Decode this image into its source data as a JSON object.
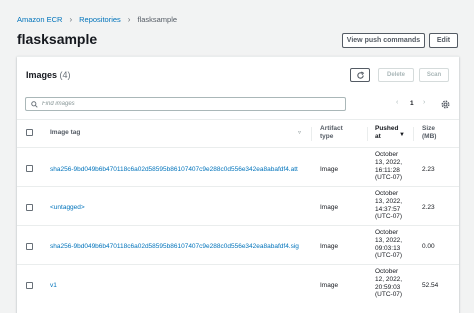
{
  "breadcrumb": [
    "Amazon ECR",
    "Repositories",
    "flasksample"
  ],
  "page": {
    "title": "flasksample",
    "view_push_commands": "View push commands",
    "edit": "Edit"
  },
  "images": {
    "title": "Images",
    "count": "(4)",
    "delete": "Delete",
    "scan": "Scan",
    "search_placeholder": "Find images",
    "page_number": "1",
    "columns": {
      "image_tag": "Image tag",
      "artifact_type": [
        "Artifact",
        "type"
      ],
      "pushed_at": [
        "Pushed",
        "at"
      ],
      "size": [
        "Size",
        "(MB)"
      ]
    },
    "rows": [
      {
        "tag": "sha256-9bd049b6b470118c6a02d58595b86107407c9e288c0d556e342ea8abafdf4.att",
        "type": "Image",
        "pushed": [
          "October",
          "13, 2022,",
          "16:11:28",
          "(UTC-07)"
        ],
        "size": "2.23"
      },
      {
        "tag": "<untagged>",
        "type": "Image",
        "pushed": [
          "October",
          "13, 2022,",
          "14:37:57",
          "(UTC-07)"
        ],
        "size": "2.23"
      },
      {
        "tag": "sha256-9bd049b6b470118c6a02d58595b86107407c9e288c0d556e342ea8abafdf4.sig",
        "type": "Image",
        "pushed": [
          "October",
          "13, 2022,",
          "09:03:13",
          "(UTC-07)"
        ],
        "size": "0.00"
      },
      {
        "tag": "v1",
        "type": "Image",
        "pushed": [
          "October",
          "12, 2022,",
          "20:59:03",
          "(UTC-07)"
        ],
        "size": "52.54"
      }
    ]
  }
}
